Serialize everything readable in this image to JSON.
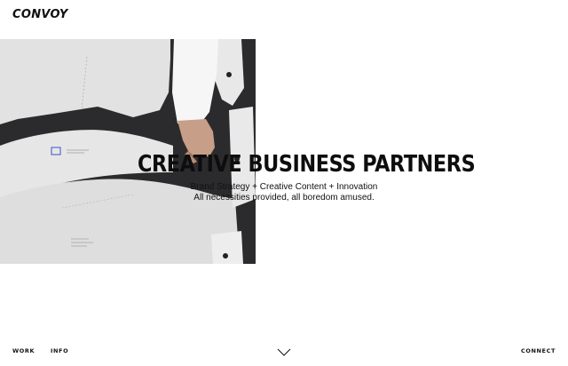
{
  "brand": {
    "logo": "CONVOY"
  },
  "hero": {
    "headline": "CREATIVE BUSINESS PARTNERS",
    "subline_1": "Brand Strategy + Creative Content + Innovation",
    "subline_2": "All necessities provided, all boredom amused."
  },
  "nav": {
    "work": "WORK",
    "info": "INFO",
    "connect": "CONNECT"
  },
  "icons": {
    "scroll": "chevron-down-icon"
  },
  "colors": {
    "text": "#111111",
    "hero_dark": "#2b2b2d",
    "paper": "#e4e4e4"
  }
}
